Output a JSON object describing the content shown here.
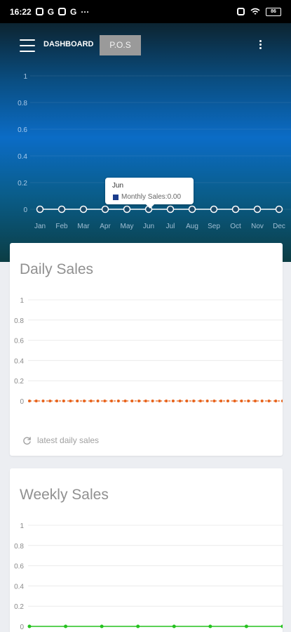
{
  "statusbar": {
    "time": "16:22",
    "icons_left": [
      "alarm-icon",
      "g-icon",
      "mail-icon",
      "g-icon"
    ],
    "more": "···",
    "battery": "86"
  },
  "topbar": {
    "title": "DASHBOARD",
    "pos_label": "P.O.S"
  },
  "tooltip": {
    "title": "Jun",
    "text": "Monthly Sales:0.00",
    "swatch_color": "#1a3c8c"
  },
  "daily": {
    "title": "Daily Sales",
    "footer": "latest daily sales"
  },
  "weekly": {
    "title": "Weekly Sales"
  },
  "chart_data": [
    {
      "type": "line",
      "name": "Monthly Sales",
      "categories": [
        "Jan",
        "Feb",
        "Mar",
        "Apr",
        "May",
        "Jun",
        "Jul",
        "Aug",
        "Sep",
        "Oct",
        "Nov",
        "Dec"
      ],
      "values": [
        0,
        0,
        0,
        0,
        0,
        0,
        0,
        0,
        0,
        0,
        0,
        0
      ],
      "yticks": [
        "1",
        "0.8",
        "0.6",
        "0.4",
        "0.2",
        "0"
      ],
      "ylim": [
        0,
        1
      ],
      "color": "#ffffff",
      "grid": true
    },
    {
      "type": "line",
      "title": "Daily Sales",
      "values": [
        0,
        0,
        0,
        0,
        0,
        0,
        0,
        0,
        0,
        0,
        0,
        0,
        0,
        0,
        0,
        0,
        0,
        0,
        0,
        0,
        0,
        0,
        0,
        0,
        0,
        0,
        0,
        0,
        0,
        0,
        0,
        0,
        0,
        0,
        0,
        0,
        0,
        0
      ],
      "yticks": [
        "1",
        "0.8",
        "0.6",
        "0.4",
        "0.2",
        "0"
      ],
      "ylim": [
        0,
        1
      ],
      "color": "#e8621a",
      "grid": true
    },
    {
      "type": "line",
      "title": "Weekly Sales",
      "values": [
        0,
        0,
        0,
        0,
        0,
        0,
        0,
        0
      ],
      "yticks": [
        "1",
        "0.8",
        "0.6",
        "0.4",
        "0.2",
        "0"
      ],
      "ylim": [
        0,
        1
      ],
      "color": "#25c21f",
      "grid": true
    }
  ]
}
